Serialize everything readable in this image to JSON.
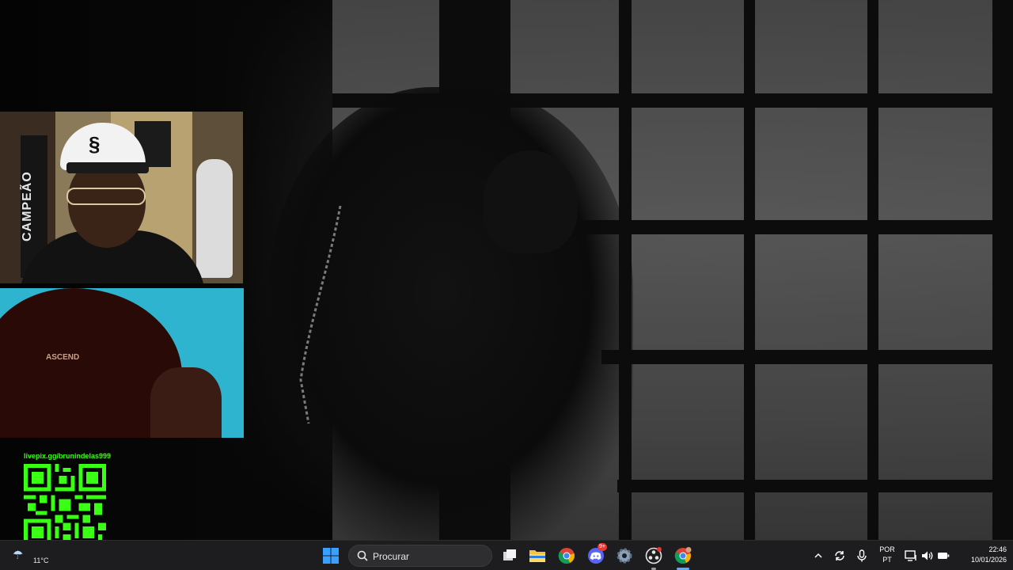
{
  "video": {
    "description_visible": false
  },
  "cam1": {
    "banner_text": "CAMPEÃO"
  },
  "cam2": {
    "shirt_text": "ASCEND"
  },
  "qr": {
    "url_text": "livepix.gg/brunindelas999",
    "color": "#39ff14"
  },
  "taskbar": {
    "weather": {
      "temp": "11°C",
      "icon": "weather-rain-icon"
    },
    "start_icon": "windows-start-icon",
    "search_placeholder": "Procurar",
    "apps": [
      {
        "name": "task-view",
        "icon": "task-view-icon"
      },
      {
        "name": "file-explorer",
        "icon": "folder-icon"
      },
      {
        "name": "chrome",
        "icon": "chrome-icon"
      },
      {
        "name": "discord",
        "icon": "discord-icon",
        "badge": "9+"
      },
      {
        "name": "settings",
        "icon": "gear-icon"
      },
      {
        "name": "obs",
        "icon": "obs-icon"
      },
      {
        "name": "chrome-active",
        "icon": "chrome-icon"
      }
    ],
    "tray": {
      "lang_line1": "POR",
      "lang_line2": "PT",
      "time": "22:46",
      "date": "10/01/2026"
    },
    "accent_blue": "#3aa0ff"
  }
}
